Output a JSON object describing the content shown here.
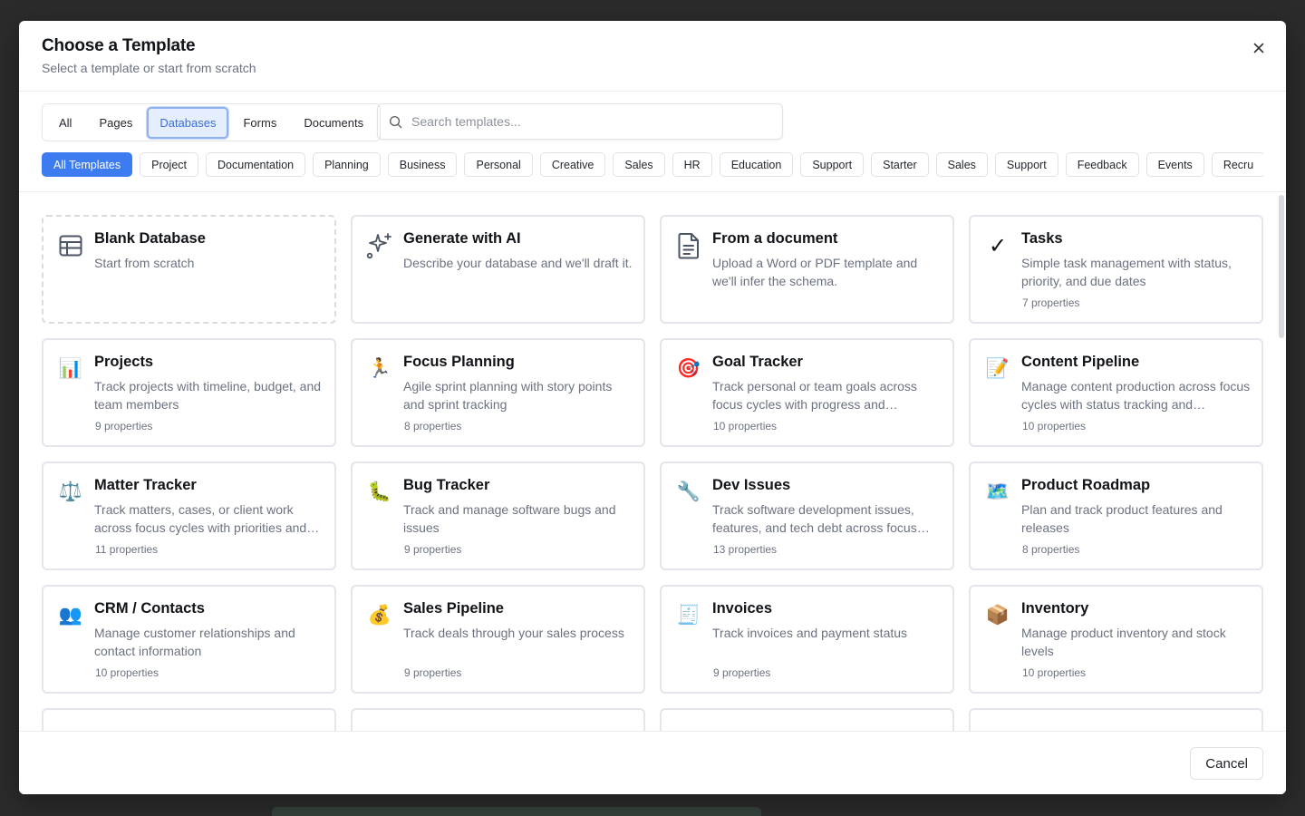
{
  "modal": {
    "title": "Choose a Template",
    "subtitle": "Select a template or start from scratch",
    "close_icon": "close-icon"
  },
  "type_tabs": [
    {
      "label": "All",
      "active": false
    },
    {
      "label": "Pages",
      "active": false
    },
    {
      "label": "Databases",
      "active": true
    },
    {
      "label": "Forms",
      "active": false
    },
    {
      "label": "Documents",
      "active": false
    }
  ],
  "search": {
    "placeholder": "Search templates...",
    "value": ""
  },
  "categories": [
    {
      "label": "All Templates",
      "active": true
    },
    {
      "label": "Project"
    },
    {
      "label": "Documentation"
    },
    {
      "label": "Planning"
    },
    {
      "label": "Business"
    },
    {
      "label": "Personal"
    },
    {
      "label": "Creative"
    },
    {
      "label": "Sales"
    },
    {
      "label": "HR"
    },
    {
      "label": "Education"
    },
    {
      "label": "Support"
    },
    {
      "label": "Starter"
    },
    {
      "label": "Sales"
    },
    {
      "label": "Support"
    },
    {
      "label": "Feedback"
    },
    {
      "label": "Events"
    },
    {
      "label": "Recru"
    }
  ],
  "cards": [
    {
      "title": "Blank Database",
      "description": "Start from scratch",
      "properties": "",
      "icon": "table-icon",
      "glyph": "",
      "dashed": true
    },
    {
      "title": "Generate with AI",
      "description": "Describe your database and we'll draft it.",
      "properties": "",
      "icon": "sparkles-icon",
      "glyph": ""
    },
    {
      "title": "From a document",
      "description": "Upload a Word or PDF template and we'll infer the schema.",
      "properties": "",
      "icon": "document-icon",
      "glyph": ""
    },
    {
      "title": "Tasks",
      "description": "Simple task management with status, priority, and due dates",
      "properties": "7 properties",
      "icon": "checkmark-icon",
      "glyph": "✓"
    },
    {
      "title": "Projects",
      "description": "Track projects with timeline, budget, and team members",
      "properties": "9 properties",
      "icon": "bar-chart-icon",
      "glyph": "📊"
    },
    {
      "title": "Focus Planning",
      "description": "Agile sprint planning with story points and sprint tracking",
      "properties": "8 properties",
      "icon": "runner-icon",
      "glyph": "🏃"
    },
    {
      "title": "Goal Tracker",
      "description": "Track personal or team goals across focus cycles with progress and milestones",
      "properties": "10 properties",
      "icon": "target-icon",
      "glyph": "🎯"
    },
    {
      "title": "Content Pipeline",
      "description": "Manage content production across focus cycles with status tracking and publishing",
      "properties": "10 properties",
      "icon": "memo-icon",
      "glyph": "📝"
    },
    {
      "title": "Matter Tracker",
      "description": "Track matters, cases, or client work across focus cycles with priorities and deadlines",
      "properties": "11 properties",
      "icon": "scales-icon",
      "glyph": "⚖️"
    },
    {
      "title": "Bug Tracker",
      "description": "Track and manage software bugs and issues",
      "properties": "9 properties",
      "icon": "bug-icon",
      "glyph": "🐛"
    },
    {
      "title": "Dev Issues",
      "description": "Track software development issues, features, and tech debt across focus cycles",
      "properties": "13 properties",
      "icon": "wrench-icon",
      "glyph": "🔧"
    },
    {
      "title": "Product Roadmap",
      "description": "Plan and track product features and releases",
      "properties": "8 properties",
      "icon": "map-icon",
      "glyph": "🗺️"
    },
    {
      "title": "CRM / Contacts",
      "description": "Manage customer relationships and contact information",
      "properties": "10 properties",
      "icon": "people-icon",
      "glyph": "👥"
    },
    {
      "title": "Sales Pipeline",
      "description": "Track deals through your sales process",
      "properties": "9 properties",
      "icon": "money-bag-icon",
      "glyph": "💰"
    },
    {
      "title": "Invoices",
      "description": "Track invoices and payment status",
      "properties": "9 properties",
      "icon": "receipt-icon",
      "glyph": "🧾"
    },
    {
      "title": "Inventory",
      "description": "Manage product inventory and stock levels",
      "properties": "10 properties",
      "icon": "package-icon",
      "glyph": "📦"
    }
  ],
  "footer": {
    "cancel_label": "Cancel"
  },
  "colors": {
    "accent": "#3d7bf0",
    "active_tab_bg": "#e4eefc",
    "border": "#e3e6ea"
  }
}
